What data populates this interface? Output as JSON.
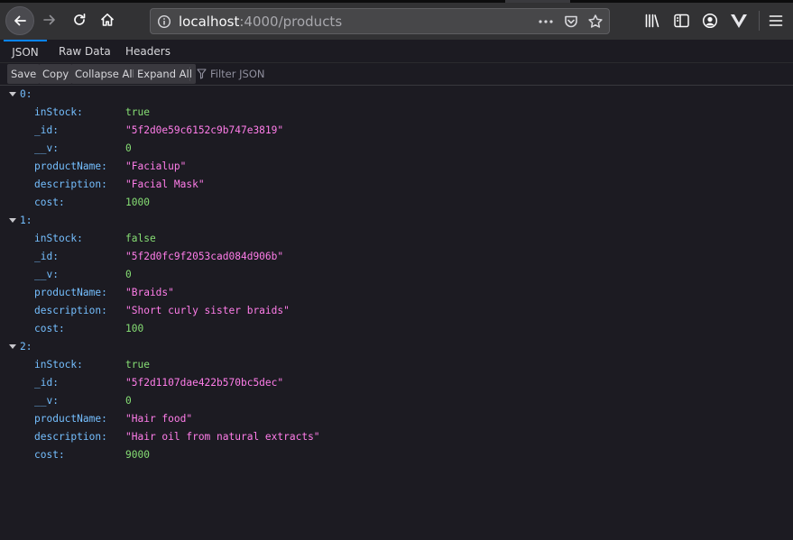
{
  "browser": {
    "url_host": "localhost",
    "url_rest": ":4000/products"
  },
  "viewer": {
    "tabs": [
      "JSON",
      "Raw Data",
      "Headers"
    ],
    "buttons": {
      "save": "Save",
      "copy": "Copy",
      "collapse_all": "Collapse All",
      "expand_all": "Expand All"
    },
    "filter_placeholder": "Filter JSON"
  },
  "colors": {
    "key": "#75bfff",
    "string": "#ff7de9",
    "number_bool": "#86de74",
    "accent": "#0a84ff"
  },
  "products": [
    {
      "index": "0:",
      "fields": [
        {
          "key": "inStock:",
          "value": "true",
          "type": "bool"
        },
        {
          "key": "_id:",
          "value": "\"5f2d0e59c6152c9b747e3819\"",
          "type": "str"
        },
        {
          "key": "__v:",
          "value": "0",
          "type": "num"
        },
        {
          "key": "productName:",
          "value": "\"Facialup\"",
          "type": "str"
        },
        {
          "key": "description:",
          "value": "\"Facial Mask\"",
          "type": "str"
        },
        {
          "key": "cost:",
          "value": "1000",
          "type": "num"
        }
      ]
    },
    {
      "index": "1:",
      "fields": [
        {
          "key": "inStock:",
          "value": "false",
          "type": "bool"
        },
        {
          "key": "_id:",
          "value": "\"5f2d0fc9f2053cad084d906b\"",
          "type": "str"
        },
        {
          "key": "__v:",
          "value": "0",
          "type": "num"
        },
        {
          "key": "productName:",
          "value": "\"Braids\"",
          "type": "str"
        },
        {
          "key": "description:",
          "value": "\"Short curly sister braids\"",
          "type": "str"
        },
        {
          "key": "cost:",
          "value": "100",
          "type": "num"
        }
      ]
    },
    {
      "index": "2:",
      "fields": [
        {
          "key": "inStock:",
          "value": "true",
          "type": "bool"
        },
        {
          "key": "_id:",
          "value": "\"5f2d1107dae422b570bc5dec\"",
          "type": "str"
        },
        {
          "key": "__v:",
          "value": "0",
          "type": "num"
        },
        {
          "key": "productName:",
          "value": "\"Hair food\"",
          "type": "str"
        },
        {
          "key": "description:",
          "value": "\"Hair oil from natural extracts\"",
          "type": "str"
        },
        {
          "key": "cost:",
          "value": "9000",
          "type": "num"
        }
      ]
    }
  ]
}
